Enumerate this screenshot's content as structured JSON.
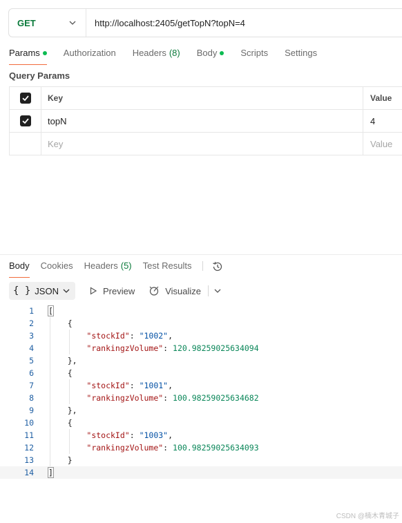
{
  "request": {
    "method": "GET",
    "url": "http://localhost:2405/getTopN?topN=4"
  },
  "request_tabs": [
    {
      "label": "Params",
      "active": true,
      "dot": true
    },
    {
      "label": "Authorization"
    },
    {
      "label": "Headers",
      "count": "(8)"
    },
    {
      "label": "Body",
      "dot": true
    },
    {
      "label": "Scripts"
    },
    {
      "label": "Settings"
    }
  ],
  "query_params": {
    "section_label": "Query Params",
    "header": {
      "key": "Key",
      "value": "Value"
    },
    "rows": [
      {
        "key": "topN",
        "value": "4",
        "checked": true
      }
    ],
    "placeholder": {
      "key": "Key",
      "value": "Value"
    }
  },
  "response_tabs": [
    {
      "label": "Body",
      "active": true
    },
    {
      "label": "Cookies"
    },
    {
      "label": "Headers",
      "count": "(5)"
    },
    {
      "label": "Test Results"
    }
  ],
  "response_toolbar": {
    "format_braces": "{ }",
    "format": "JSON",
    "preview": "Preview",
    "visualize": "Visualize"
  },
  "response_body": [
    {
      "n": "1",
      "t": "["
    },
    {
      "n": "2",
      "t": "    {"
    },
    {
      "n": "3",
      "t": "        \"stockId\": \"1002\","
    },
    {
      "n": "4",
      "t": "        \"rankingzVolume\": 120.98259025634094"
    },
    {
      "n": "5",
      "t": "    },"
    },
    {
      "n": "6",
      "t": "    {"
    },
    {
      "n": "7",
      "t": "        \"stockId\": \"1001\","
    },
    {
      "n": "8",
      "t": "        \"rankingzVolume\": 100.98259025634682"
    },
    {
      "n": "9",
      "t": "    },"
    },
    {
      "n": "10",
      "t": "    {"
    },
    {
      "n": "11",
      "t": "        \"stockId\": \"1003\","
    },
    {
      "n": "12",
      "t": "        \"rankingzVolume\": 100.98259025634093"
    },
    {
      "n": "13",
      "t": "    }"
    },
    {
      "n": "14",
      "t": "]"
    }
  ],
  "watermark": "CSDN @楠木青城子",
  "colors": {
    "accent_tab": "#f26b3a",
    "method_get": "#0b7a3b",
    "status_dot": "#0cbb52",
    "json_key": "#a31515",
    "json_string": "#0451a5",
    "json_number": "#098658",
    "line_number": "#1f5fa3"
  }
}
